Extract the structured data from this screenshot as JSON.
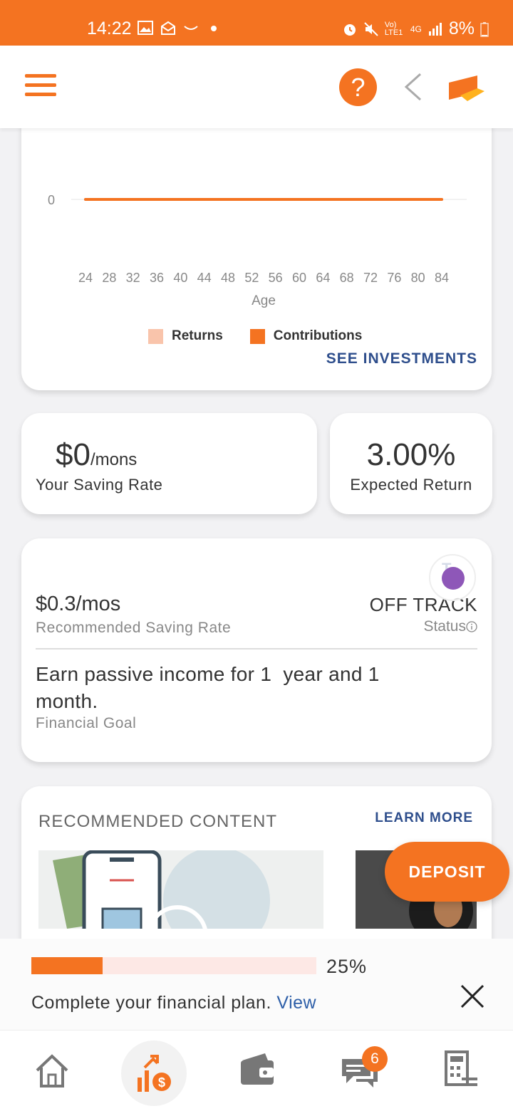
{
  "statusbar": {
    "time": "14:22",
    "network": "Vo) LTE1",
    "network_type": "4G",
    "battery": "8%"
  },
  "colors": {
    "brand": "#f47321",
    "link": "#2e4e8c",
    "returns": "#f9c4ab",
    "contributions": "#f47321"
  },
  "chart_data": {
    "type": "line",
    "x": [
      24,
      28,
      32,
      36,
      40,
      44,
      48,
      52,
      56,
      60,
      64,
      68,
      72,
      76,
      80,
      84
    ],
    "y_ticks": [
      "0"
    ],
    "series": [
      {
        "name": "Contributions",
        "values": [
          0,
          0,
          0,
          0,
          0,
          0,
          0,
          0,
          0,
          0,
          0,
          0,
          0,
          0,
          0,
          0
        ]
      },
      {
        "name": "Returns",
        "values": [
          0,
          0,
          0,
          0,
          0,
          0,
          0,
          0,
          0,
          0,
          0,
          0,
          0,
          0,
          0,
          0
        ]
      }
    ],
    "xlabel": "Age",
    "legend": [
      "Returns",
      "Contributions"
    ]
  },
  "chart_card": {
    "see_investments": "SEE INVESTMENTS"
  },
  "saving_rate": {
    "value": "$0",
    "unit": "/mons",
    "label": "Your Saving Rate"
  },
  "expected_return": {
    "value": "3.00%",
    "label": "Expected Return"
  },
  "recommendation": {
    "bg_text": "T",
    "rate": "$0.3/mos",
    "rate_label": "Recommended Saving Rate",
    "status": "OFF TRACK",
    "status_label": "Status",
    "goal": "Earn passive income for 1  year and 1 month.",
    "goal_label": "Financial Goal"
  },
  "content": {
    "title": "RECOMMENDED CONTENT",
    "learn_more": "LEARN MORE"
  },
  "deposit": {
    "label": "DEPOSIT"
  },
  "progress": {
    "value": 0.25,
    "percent_text": "25%",
    "text": "Complete your financial plan.",
    "link": "View"
  },
  "nav": {
    "messages_badge": "6"
  }
}
